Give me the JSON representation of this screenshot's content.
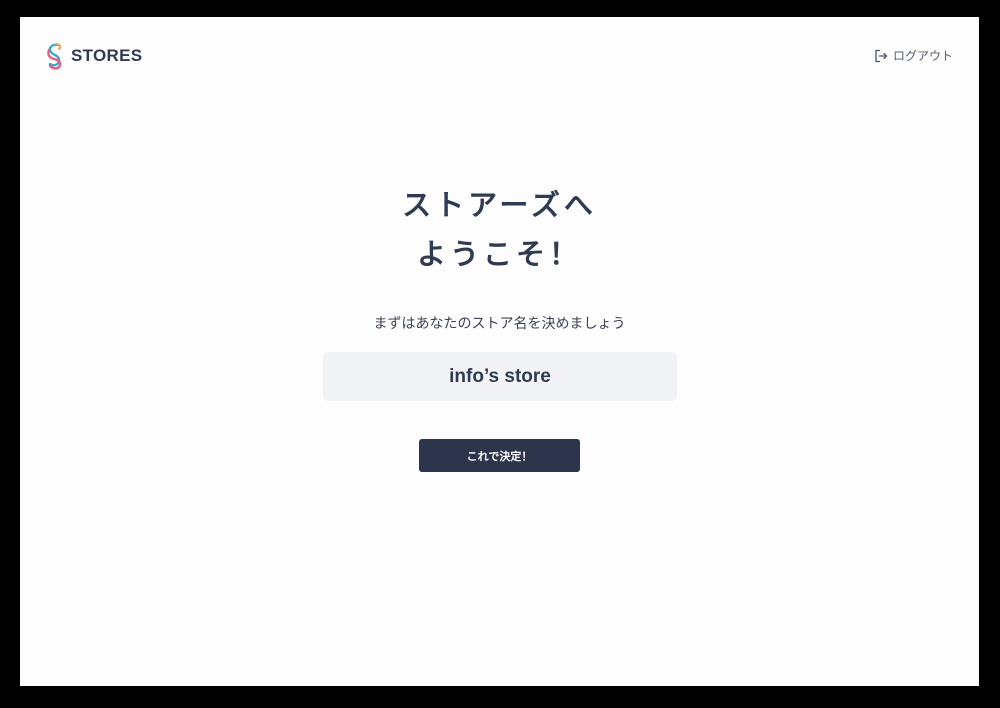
{
  "header": {
    "logo_text": "STORES",
    "logo_icon": "stores-logo-mark",
    "logout_icon": "logout-icon",
    "logout_label": "ログアウト"
  },
  "main": {
    "title_line1": "ストアーズへ",
    "title_line2": "ようこそ！",
    "subtitle": "まずはあなたのストア名を決めましょう",
    "store_name_value": "info’s store",
    "confirm_label": "これで決定！"
  },
  "colors": {
    "background": "#fdfdfd",
    "frame": "#000000",
    "text_primary": "#2f3b52",
    "input_background": "#f2f3f7",
    "button_background": "#2c354b",
    "button_text": "#ffffff",
    "logo_accent_teal": "#3fa9c9",
    "logo_accent_pink": "#e5607a"
  }
}
